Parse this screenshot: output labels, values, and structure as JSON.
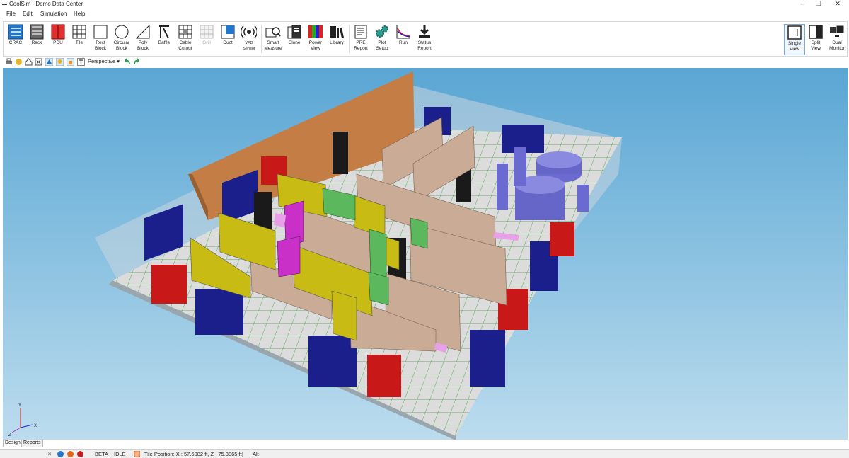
{
  "window": {
    "title": "CoolSim - Demo Data Center",
    "minimize": "–",
    "restore": "❐",
    "close": "✕"
  },
  "menu": [
    "File",
    "Edit",
    "Simulation",
    "Help"
  ],
  "ribbon": {
    "tools": [
      {
        "id": "crac",
        "label": "CRAC"
      },
      {
        "id": "rack",
        "label": "Rack"
      },
      {
        "id": "pdu",
        "label": "PDU"
      },
      {
        "id": "tile",
        "label": "Tile"
      },
      {
        "id": "rect-block",
        "label": "Rect\nBlock"
      },
      {
        "id": "circular-block",
        "label": "Circular\nBlock"
      },
      {
        "id": "poly-block",
        "label": "Poly\nBlock"
      },
      {
        "id": "baffle",
        "label": "Baffle"
      },
      {
        "id": "cable-cutout",
        "label": "Cable\nCutout"
      },
      {
        "id": "grill",
        "label": "Grill"
      },
      {
        "id": "duct",
        "label": "Duct"
      },
      {
        "id": "vfd-sensor",
        "label": "VFD\nSensor"
      },
      {
        "id": "smart-measure",
        "label": "Smart\nMeasure"
      },
      {
        "id": "clone",
        "label": "Clone"
      },
      {
        "id": "power-view",
        "label": "Power\nView"
      },
      {
        "id": "library",
        "label": "Library"
      },
      {
        "id": "pre-report",
        "label": "PRE\nReport"
      },
      {
        "id": "plot-setup",
        "label": "Plot\nSetup"
      },
      {
        "id": "run",
        "label": "Run"
      },
      {
        "id": "status-report",
        "label": "Status\nReport"
      }
    ],
    "views": [
      {
        "id": "single-view",
        "label": "Single\nView"
      },
      {
        "id": "split-view",
        "label": "Split\nView"
      },
      {
        "id": "dual-monitor",
        "label": "Dual\nMonitor"
      }
    ]
  },
  "toolbar2": {
    "camera_mode": "Perspective",
    "text_tool": "T"
  },
  "tabs": [
    "Design",
    "Reports"
  ],
  "axes": {
    "y": "Y",
    "x": "X",
    "z": "Z"
  },
  "status": {
    "build": "BETA",
    "state": "IDLE",
    "tile_position": "Tile Position: X : 57.6082 ft, Z : 75.3865 ft",
    "divider": "|",
    "shortcut": "Alt-"
  }
}
